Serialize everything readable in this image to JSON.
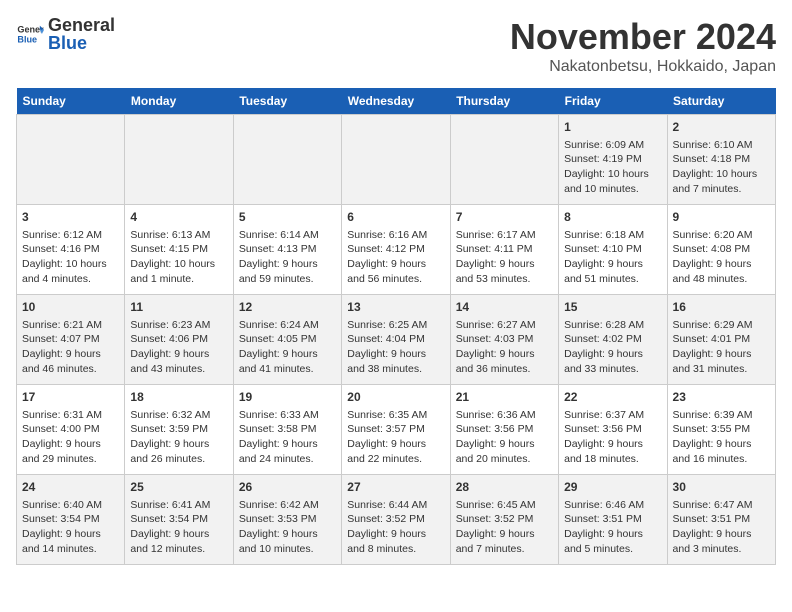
{
  "header": {
    "logo_general": "General",
    "logo_blue": "Blue",
    "month": "November 2024",
    "location": "Nakatonbetsu, Hokkaido, Japan"
  },
  "weekdays": [
    "Sunday",
    "Monday",
    "Tuesday",
    "Wednesday",
    "Thursday",
    "Friday",
    "Saturday"
  ],
  "weeks": [
    [
      {
        "day": "",
        "info": ""
      },
      {
        "day": "",
        "info": ""
      },
      {
        "day": "",
        "info": ""
      },
      {
        "day": "",
        "info": ""
      },
      {
        "day": "",
        "info": ""
      },
      {
        "day": "1",
        "info": "Sunrise: 6:09 AM\nSunset: 4:19 PM\nDaylight: 10 hours and 10 minutes."
      },
      {
        "day": "2",
        "info": "Sunrise: 6:10 AM\nSunset: 4:18 PM\nDaylight: 10 hours and 7 minutes."
      }
    ],
    [
      {
        "day": "3",
        "info": "Sunrise: 6:12 AM\nSunset: 4:16 PM\nDaylight: 10 hours and 4 minutes."
      },
      {
        "day": "4",
        "info": "Sunrise: 6:13 AM\nSunset: 4:15 PM\nDaylight: 10 hours and 1 minute."
      },
      {
        "day": "5",
        "info": "Sunrise: 6:14 AM\nSunset: 4:13 PM\nDaylight: 9 hours and 59 minutes."
      },
      {
        "day": "6",
        "info": "Sunrise: 6:16 AM\nSunset: 4:12 PM\nDaylight: 9 hours and 56 minutes."
      },
      {
        "day": "7",
        "info": "Sunrise: 6:17 AM\nSunset: 4:11 PM\nDaylight: 9 hours and 53 minutes."
      },
      {
        "day": "8",
        "info": "Sunrise: 6:18 AM\nSunset: 4:10 PM\nDaylight: 9 hours and 51 minutes."
      },
      {
        "day": "9",
        "info": "Sunrise: 6:20 AM\nSunset: 4:08 PM\nDaylight: 9 hours and 48 minutes."
      }
    ],
    [
      {
        "day": "10",
        "info": "Sunrise: 6:21 AM\nSunset: 4:07 PM\nDaylight: 9 hours and 46 minutes."
      },
      {
        "day": "11",
        "info": "Sunrise: 6:23 AM\nSunset: 4:06 PM\nDaylight: 9 hours and 43 minutes."
      },
      {
        "day": "12",
        "info": "Sunrise: 6:24 AM\nSunset: 4:05 PM\nDaylight: 9 hours and 41 minutes."
      },
      {
        "day": "13",
        "info": "Sunrise: 6:25 AM\nSunset: 4:04 PM\nDaylight: 9 hours and 38 minutes."
      },
      {
        "day": "14",
        "info": "Sunrise: 6:27 AM\nSunset: 4:03 PM\nDaylight: 9 hours and 36 minutes."
      },
      {
        "day": "15",
        "info": "Sunrise: 6:28 AM\nSunset: 4:02 PM\nDaylight: 9 hours and 33 minutes."
      },
      {
        "day": "16",
        "info": "Sunrise: 6:29 AM\nSunset: 4:01 PM\nDaylight: 9 hours and 31 minutes."
      }
    ],
    [
      {
        "day": "17",
        "info": "Sunrise: 6:31 AM\nSunset: 4:00 PM\nDaylight: 9 hours and 29 minutes."
      },
      {
        "day": "18",
        "info": "Sunrise: 6:32 AM\nSunset: 3:59 PM\nDaylight: 9 hours and 26 minutes."
      },
      {
        "day": "19",
        "info": "Sunrise: 6:33 AM\nSunset: 3:58 PM\nDaylight: 9 hours and 24 minutes."
      },
      {
        "day": "20",
        "info": "Sunrise: 6:35 AM\nSunset: 3:57 PM\nDaylight: 9 hours and 22 minutes."
      },
      {
        "day": "21",
        "info": "Sunrise: 6:36 AM\nSunset: 3:56 PM\nDaylight: 9 hours and 20 minutes."
      },
      {
        "day": "22",
        "info": "Sunrise: 6:37 AM\nSunset: 3:56 PM\nDaylight: 9 hours and 18 minutes."
      },
      {
        "day": "23",
        "info": "Sunrise: 6:39 AM\nSunset: 3:55 PM\nDaylight: 9 hours and 16 minutes."
      }
    ],
    [
      {
        "day": "24",
        "info": "Sunrise: 6:40 AM\nSunset: 3:54 PM\nDaylight: 9 hours and 14 minutes."
      },
      {
        "day": "25",
        "info": "Sunrise: 6:41 AM\nSunset: 3:54 PM\nDaylight: 9 hours and 12 minutes."
      },
      {
        "day": "26",
        "info": "Sunrise: 6:42 AM\nSunset: 3:53 PM\nDaylight: 9 hours and 10 minutes."
      },
      {
        "day": "27",
        "info": "Sunrise: 6:44 AM\nSunset: 3:52 PM\nDaylight: 9 hours and 8 minutes."
      },
      {
        "day": "28",
        "info": "Sunrise: 6:45 AM\nSunset: 3:52 PM\nDaylight: 9 hours and 7 minutes."
      },
      {
        "day": "29",
        "info": "Sunrise: 6:46 AM\nSunset: 3:51 PM\nDaylight: 9 hours and 5 minutes."
      },
      {
        "day": "30",
        "info": "Sunrise: 6:47 AM\nSunset: 3:51 PM\nDaylight: 9 hours and 3 minutes."
      }
    ]
  ]
}
